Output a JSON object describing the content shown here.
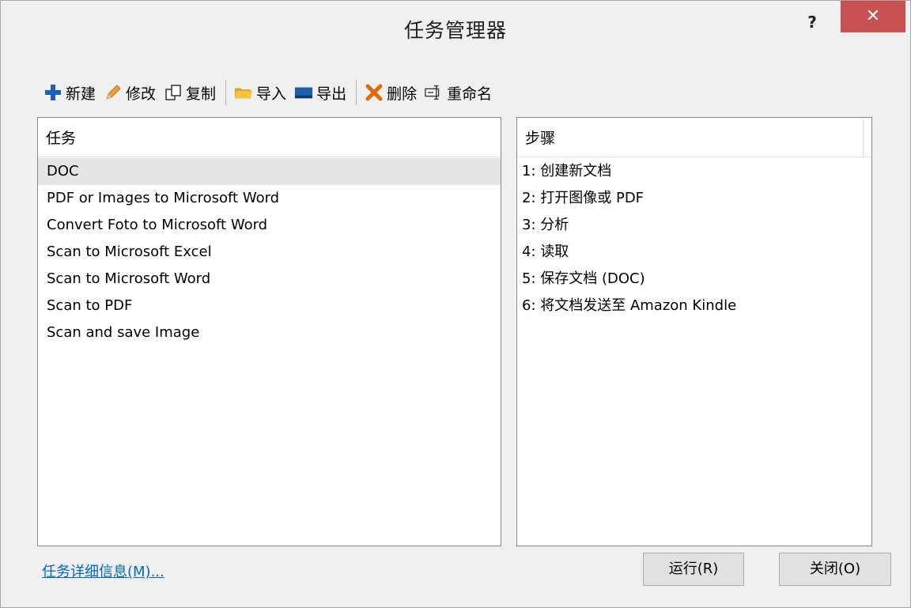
{
  "window": {
    "title": "任务管理器",
    "help": "?",
    "close": "✕"
  },
  "toolbar": {
    "new": "新建",
    "edit": "修改",
    "copy": "复制",
    "import": "导入",
    "export": "导出",
    "delete": "删除",
    "rename": "重命名"
  },
  "tasks": {
    "header": "任务",
    "items": [
      "DOC",
      "PDF or Images to Microsoft Word",
      "Convert Foto to Microsoft Word",
      "Scan to Microsoft Excel",
      "Scan to Microsoft Word",
      "Scan to PDF",
      "Scan and save Image"
    ],
    "selected_index": 0
  },
  "steps": {
    "header": "步骤",
    "items": [
      "1: 创建新文档",
      "2: 打开图像或 PDF",
      "3: 分析",
      "4: 读取",
      "5: 保存文档 (DOC)",
      "6: 将文档发送至 Amazon Kindle"
    ]
  },
  "footer": {
    "details_link": "任务详细信息(M)...",
    "run": "运行(R)",
    "close": "关闭(O)"
  },
  "colors": {
    "close_button": "#c75050",
    "link": "#0066cc",
    "selection": "#e6e6e6"
  }
}
